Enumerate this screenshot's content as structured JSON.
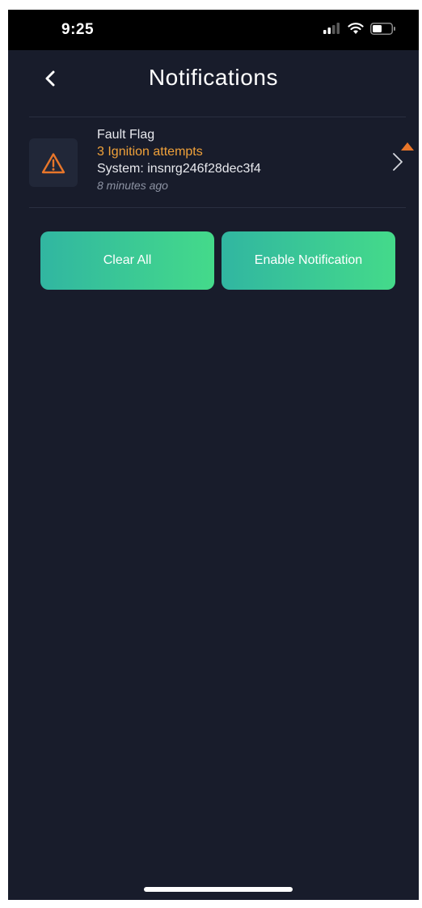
{
  "status_bar": {
    "time": "9:25",
    "icons": [
      "cellular-signal-icon",
      "wifi-icon",
      "battery-icon"
    ]
  },
  "header": {
    "back_icon": "chevron-left-icon",
    "title": "Notifications"
  },
  "notifications": [
    {
      "icon": "warning-triangle-icon",
      "title": "Fault Flag",
      "subtitle": "3 Ignition attempts",
      "system": "System: insnrg246f28dec3f4",
      "time": "8 minutes ago",
      "chevron_icon": "chevron-right-icon"
    }
  ],
  "actions": {
    "clear_all_label": "Clear All",
    "enable_label": "Enable Notification"
  },
  "colors": {
    "background": "#181c2b",
    "status_bar": "#000000",
    "warning": "#e8762a",
    "subtitle": "#f0a13a",
    "button_gradient_start": "#31b6a1",
    "button_gradient_end": "#44da8a"
  }
}
